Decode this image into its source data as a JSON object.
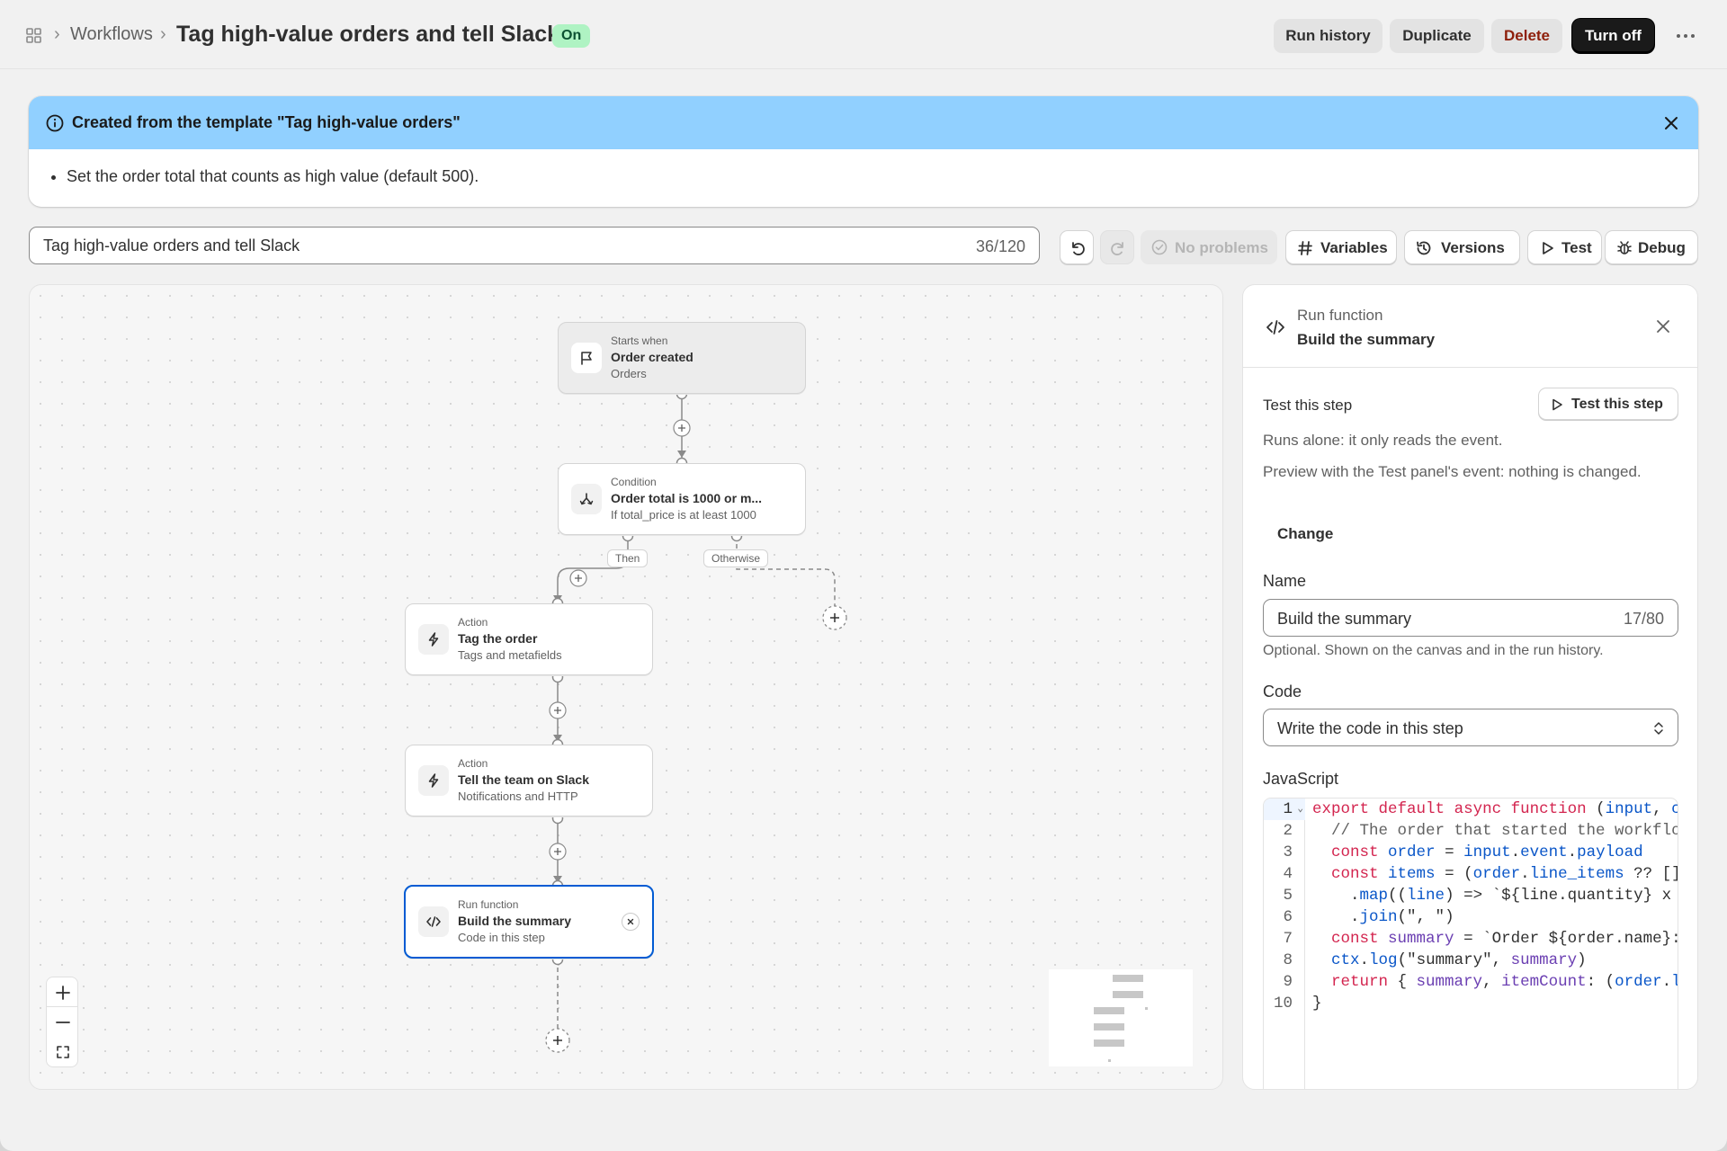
{
  "header": {
    "breadcrumb_link": "Workflows",
    "title": "Tag high-value orders and tell Slack",
    "status": "On",
    "actions": {
      "run_history": "Run history",
      "duplicate": "Duplicate",
      "delete": "Delete",
      "turn_off": "Turn off"
    }
  },
  "banner": {
    "title": "Created from the template \"Tag high-value orders\"",
    "items": [
      "Set the order total that counts as high value (default 500)."
    ]
  },
  "toolbar": {
    "name_value": "Tag high-value orders and tell Slack",
    "name_count": "36/120",
    "no_problems": "No problems",
    "variables": "Variables",
    "versions": "Versions",
    "test": "Test",
    "debug": "Debug"
  },
  "canvas": {
    "nodes": {
      "trigger": {
        "kicker": "Starts when",
        "title": "Order created",
        "sub": "Orders"
      },
      "condition": {
        "kicker": "Condition",
        "title": "Order total is 1000 or m...",
        "sub": "If total_price is at least 1000"
      },
      "action_tag": {
        "kicker": "Action",
        "title": "Tag the order",
        "sub": "Tags and metafields"
      },
      "action_slack": {
        "kicker": "Action",
        "title": "Tell the team on Slack",
        "sub": "Notifications and HTTP"
      },
      "run_function": {
        "kicker": "Run function",
        "title": "Build the summary",
        "sub": "Code in this step"
      }
    },
    "edge_labels": {
      "then": "Then",
      "otherwise": "Otherwise"
    }
  },
  "panel": {
    "kicker": "Run function",
    "title": "Build the summary",
    "test_section_label": "Test this step",
    "test_button": "Test this step",
    "runs_alone": "Runs alone: it only reads the event.",
    "preview_text": "Preview with the Test panel's event: nothing is changed.",
    "change_link": "Change",
    "name_label": "Name",
    "name_value": "Build the summary",
    "name_count": "17/80",
    "name_help": "Optional. Shown on the canvas and in the run history.",
    "code_label": "Code",
    "code_select_value": "Write the code in this step",
    "js_label": "JavaScript",
    "code_lines": [
      "export default async function (input, c",
      "  // The order that started the workflo",
      "  const order = input.event.payload",
      "  const items = (order.line_items ?? []",
      "    .map((line) => `${line.quantity} x",
      "    .join(\", \")",
      "  const summary = `Order ${order.name}:",
      "  ctx.log(\"summary\", summary)",
      "  return { summary, itemCount: (order.l",
      "}"
    ]
  },
  "colors": {
    "accent": "#005bd3",
    "banner_bg": "#91d0ff",
    "status_badge_bg": "#aff3c3",
    "primary_button": "#1a1a1a",
    "delete_text": "#8e1f0b"
  }
}
